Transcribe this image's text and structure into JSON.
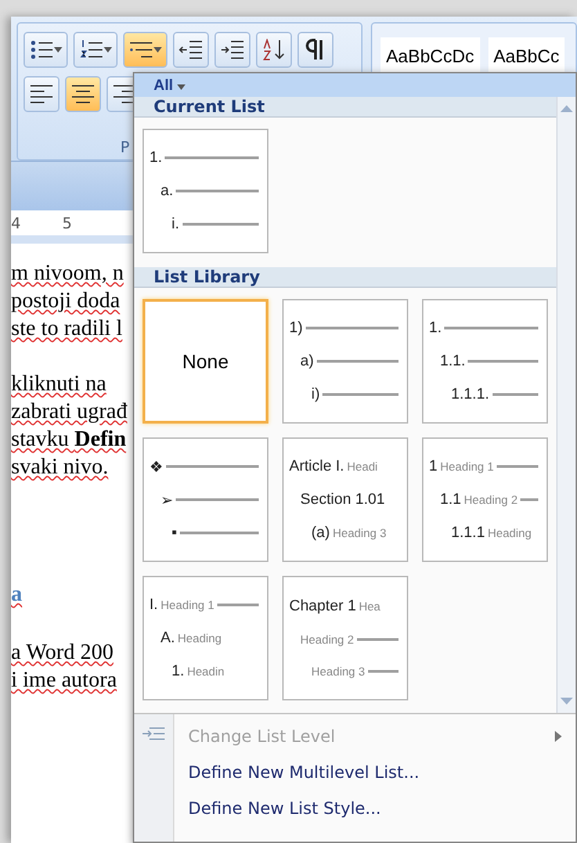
{
  "ribbon": {
    "buttons_row_1": [
      {
        "kind": "bullets",
        "selected": false
      },
      {
        "kind": "numbering",
        "selected": false
      },
      {
        "kind": "multilevel",
        "selected": true
      },
      {
        "kind": "outdent",
        "selected": false
      },
      {
        "kind": "indent",
        "selected": false
      },
      {
        "kind": "sort",
        "selected": false
      },
      {
        "kind": "pilcrow",
        "selected": false
      }
    ],
    "buttons_row_2": [
      {
        "kind": "align-left",
        "selected": false
      },
      {
        "kind": "align-center",
        "selected": true
      },
      {
        "kind": "align-right",
        "selected": false
      }
    ],
    "group_label": "P",
    "styles": [
      "AaBbCcDc",
      "AaBbCc"
    ]
  },
  "ruler": [
    "4",
    "5"
  ],
  "document": [
    {
      "text": "m nivoom, n",
      "kind": "body"
    },
    {
      "text": "postoji doda",
      "kind": "body"
    },
    {
      "text": "ste to radili l",
      "kind": "body"
    },
    {
      "text": "kliknuti na",
      "kind": "paragraph-start"
    },
    {
      "text": "zabrati ugrađ",
      "kind": "body"
    },
    {
      "text": "stavku **Defin**",
      "kind": "body"
    },
    {
      "text": "svaki nivo.",
      "kind": "body"
    },
    {
      "text": "a",
      "kind": "heading"
    },
    {
      "text": "a Word 200",
      "kind": "body"
    },
    {
      "text": "i ime autora",
      "kind": "body"
    }
  ],
  "dropdown": {
    "filter": "All",
    "current_list": {
      "title": "Current List",
      "items": [
        {
          "kind": "levels",
          "selected": false,
          "lines": [
            {
              "number": "1.",
              "rule": true
            },
            {
              "number": "a.",
              "rule": true
            },
            {
              "number": "i.",
              "rule": true
            }
          ]
        }
      ]
    },
    "list_library": {
      "title": "List Library",
      "items": [
        {
          "kind": "none",
          "label": "None",
          "selected": true
        },
        {
          "kind": "levels",
          "selected": false,
          "lines": [
            {
              "number": "1)",
              "rule": true
            },
            {
              "number": "a)",
              "rule": true
            },
            {
              "number": "i)",
              "rule": true
            }
          ]
        },
        {
          "kind": "levels",
          "selected": false,
          "lines": [
            {
              "number": "1.",
              "rule": true
            },
            {
              "number": "1.1.",
              "rule": true
            },
            {
              "number": "1.1.1.",
              "rule": true
            }
          ]
        },
        {
          "kind": "levels",
          "selected": false,
          "lines": [
            {
              "number": "❖",
              "rule": true
            },
            {
              "number": "➢",
              "rule": true
            },
            {
              "number": "▪",
              "rule": true
            }
          ]
        },
        {
          "kind": "levels",
          "selected": false,
          "lines": [
            {
              "number": "Article I.",
              "heading": "Headi",
              "rule": false
            },
            {
              "number": "Section 1.01",
              "rule": false
            },
            {
              "number": "(a)",
              "heading": "Heading 3",
              "rule": false
            }
          ]
        },
        {
          "kind": "levels",
          "selected": false,
          "lines": [
            {
              "number": "1",
              "heading": "Heading 1",
              "rule": true
            },
            {
              "number": "1.1",
              "heading": "Heading 2",
              "rule": true
            },
            {
              "number": "1.1.1",
              "heading": "Heading",
              "rule": false
            }
          ]
        },
        {
          "kind": "levels",
          "selected": false,
          "lines": [
            {
              "number": "I.",
              "heading": "Heading 1",
              "rule": true
            },
            {
              "number": "A.",
              "heading": "Heading",
              "rule": false
            },
            {
              "number": "1.",
              "heading": "Headin",
              "rule": false
            }
          ]
        },
        {
          "kind": "levels",
          "selected": false,
          "lines": [
            {
              "number": "Chapter 1",
              "heading": "Hea",
              "rule": false
            },
            {
              "heading": "Heading 2",
              "rule": true
            },
            {
              "heading": "Heading 3",
              "rule": true
            }
          ]
        }
      ]
    },
    "menu": [
      {
        "label": "Change List Level",
        "disabled": true,
        "submenu": true
      },
      {
        "label": "Define New Multilevel List...",
        "disabled": false,
        "submenu": false
      },
      {
        "label": "Define New List Style...",
        "disabled": false,
        "submenu": false
      }
    ]
  }
}
